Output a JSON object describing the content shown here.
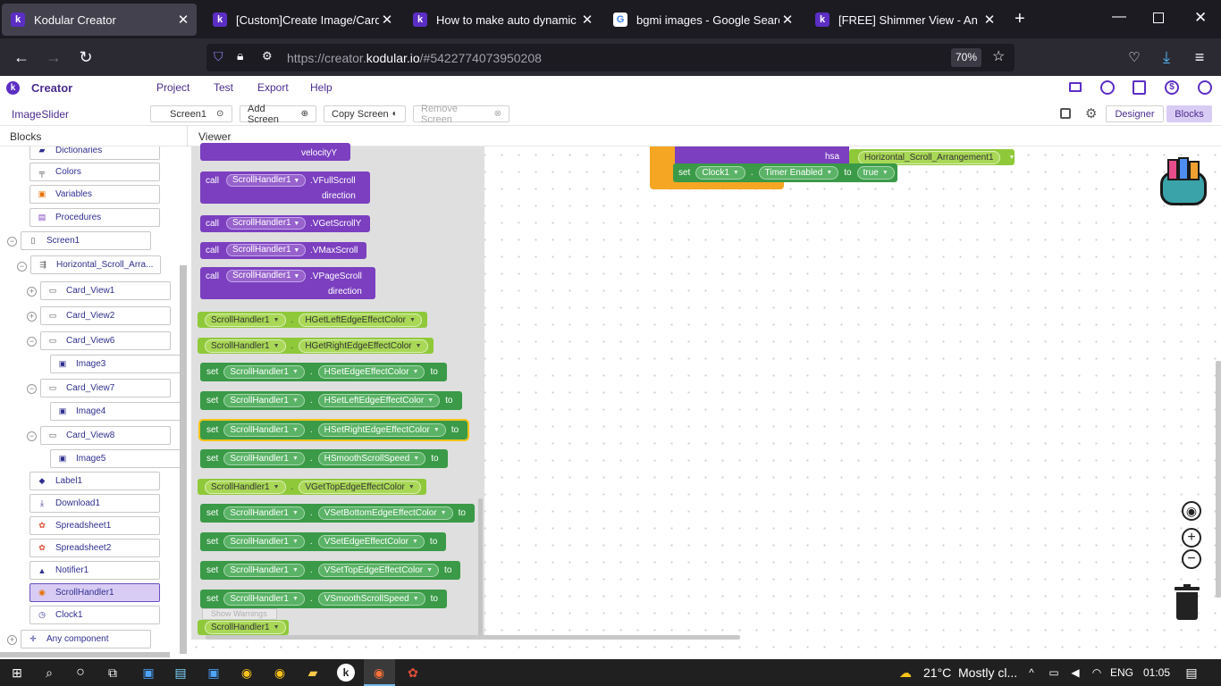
{
  "browser": {
    "tabs": [
      {
        "title": "Kodular Creator",
        "icon": "kodular-k-icon",
        "color": "#5b2ec4"
      },
      {
        "title": "[Custom]Create Image/Card/La",
        "icon": "kodular-k-icon",
        "color": "#5b2ec4"
      },
      {
        "title": "How to make auto dynamic ima",
        "icon": "kodular-k-icon",
        "color": "#5b2ec4"
      },
      {
        "title": "bgmi images - Google Search",
        "icon": "google-g-icon",
        "color": "#ffffff"
      },
      {
        "title": "[FREE] Shimmer View - An exter",
        "icon": "kodular-k-icon",
        "color": "#5b2ec4"
      }
    ],
    "url_prefix": "https://creator.",
    "url_host": "kodular.io",
    "url_path": "/#5422774073950208",
    "zoom": "70%"
  },
  "app": {
    "logo_text": "Creator",
    "menu": [
      "Project",
      "Test",
      "Export",
      "Help"
    ],
    "project_name": "ImageSlider",
    "screen_select": "Screen1",
    "add_screen": "Add Screen",
    "copy_screen": "Copy Screen",
    "remove_screen": "Remove Screen",
    "designer": "Designer",
    "blocks": "Blocks",
    "blocks_header": "Blocks",
    "viewer_header": "Viewer"
  },
  "tree": [
    {
      "label": "Dictionaries",
      "icon": "dictionary-icon"
    },
    {
      "label": "Colors",
      "icon": "palette-icon"
    },
    {
      "label": "Variables",
      "icon": "variable-icon"
    },
    {
      "label": "Procedures",
      "icon": "procedure-icon"
    },
    {
      "label": "Screen1",
      "icon": "phone-icon"
    },
    {
      "label": "Horizontal_Scroll_Arra...",
      "icon": "horizontal-arrangement-icon"
    },
    {
      "label": "Card_View1",
      "icon": "card-icon"
    },
    {
      "label": "Card_View2",
      "icon": "card-icon"
    },
    {
      "label": "Card_View6",
      "icon": "card-icon"
    },
    {
      "label": "Image3",
      "icon": "image-icon"
    },
    {
      "label": "Card_View7",
      "icon": "card-icon"
    },
    {
      "label": "Image4",
      "icon": "image-icon"
    },
    {
      "label": "Card_View8",
      "icon": "card-icon"
    },
    {
      "label": "Image5",
      "icon": "image-icon"
    },
    {
      "label": "Label1",
      "icon": "label-icon"
    },
    {
      "label": "Download1",
      "icon": "download-icon"
    },
    {
      "label": "Spreadsheet1",
      "icon": "spreadsheet-icon"
    },
    {
      "label": "Spreadsheet2",
      "icon": "spreadsheet-icon"
    },
    {
      "label": "Notifier1",
      "icon": "bell-icon"
    },
    {
      "label": "ScrollHandler1",
      "icon": "scroll-handler-icon"
    },
    {
      "label": "Clock1",
      "icon": "clock-icon"
    },
    {
      "label": "Any component",
      "icon": "plus-icon"
    }
  ],
  "blocks": {
    "call": "call",
    "set": "set",
    "to": "to",
    "component": "ScrollHandler1",
    "velocityY": "velocityY",
    "direction": "direction",
    "vfullscroll": ".VFullScroll",
    "vgetscrolly": ".VGetScrollY",
    "vmaxscroll": ".VMaxScroll",
    "vpagescroll": ".VPageScroll",
    "getters": [
      "HGetLeftEdgeEffectColor",
      "HGetRightEdgeEffectColor",
      "VGetTopEdgeEffectColor"
    ],
    "setters": [
      "HSetEdgeEffectColor",
      "HSetLeftEdgeEffectColor",
      "HSetRightEdgeEffectColor",
      "HSmoothScrollSpeed",
      "VSetBottomEdgeEffectColor",
      "VSetEdgeEffectColor",
      "VSetTopEdgeEffectColor",
      "VSmoothScrollSpeed"
    ],
    "show_warnings": "Show Warnings",
    "hsa": "hsa",
    "hsa_value": "Horizontal_Scroll_Arrangement1",
    "clock": "Clock1",
    "timer_enabled": "Timer Enabled",
    "true_value": "true"
  },
  "taskbar": {
    "temperature": "21°C",
    "weather": "Mostly cl...",
    "language": "ENG",
    "time": "01:05"
  }
}
